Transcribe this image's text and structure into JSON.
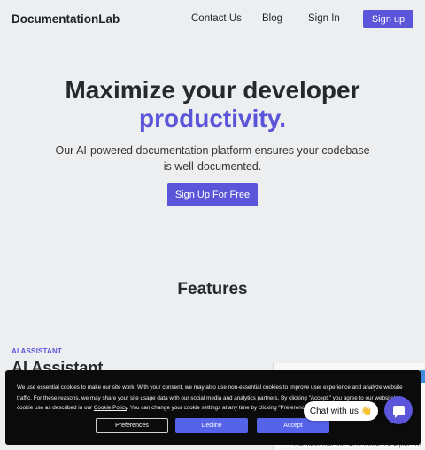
{
  "nav": {
    "logo": "DocumentationLab",
    "links": [
      "Contact Us",
      "Blog",
      "Sign In"
    ],
    "signup": "Sign up"
  },
  "hero": {
    "title_line1": "Maximize your developer",
    "title_line2": "productivity.",
    "subtitle": "Our AI-powered documentation platform ensures your codebase is well-documented.",
    "cta": "Sign Up For Free"
  },
  "features": {
    "title": "Features",
    "tag": "AI ASSISTANT",
    "heading": "AI Assistant"
  },
  "code": {
    "lines": [
      "}",
      "the destination attribute is equal to \"LAX\""
    ]
  },
  "cookie": {
    "text_before": "We use essential cookies to make our site work. With your consent, we may also use non-essential cookies to improve user experience and analyze website traffic. For these reasons, we may share your site usage data with our social media and analytics partners. By clicking \"Accept,\" you agree to our website's cookie use as described in our ",
    "link": "Cookie Policy",
    "text_after": ". You can change your cookie settings at any time by clicking \"Preferences.\"",
    "preferences": "Preferences",
    "decline": "Decline",
    "accept": "Accept"
  },
  "chat": {
    "label": "Chat with us 👋"
  },
  "colors": {
    "accent": "#5b55d9",
    "cookie_button": "#5463e8",
    "background": "#eceef0",
    "banner": "#0b0b0c"
  }
}
